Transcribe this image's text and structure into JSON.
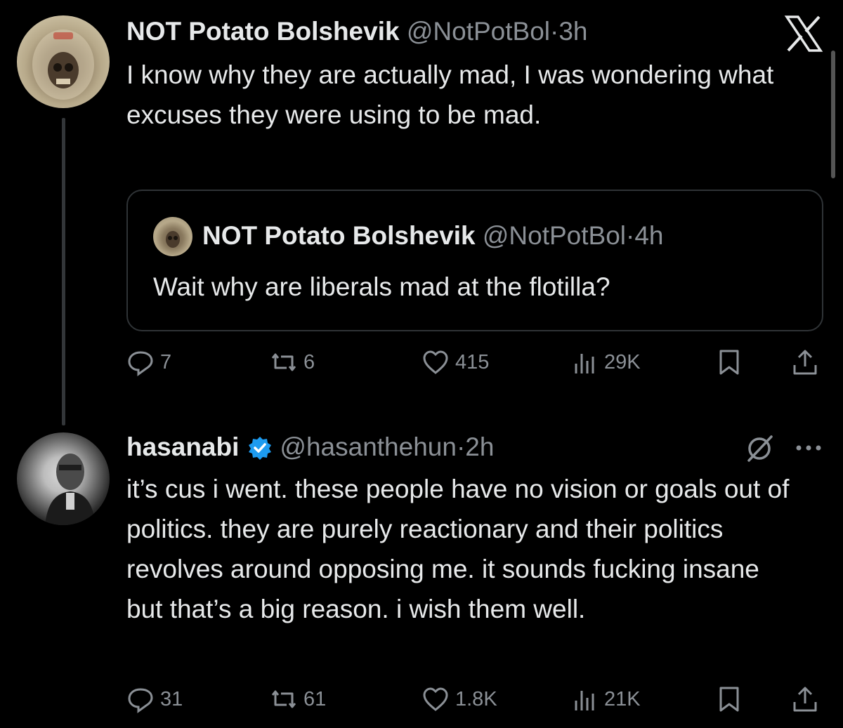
{
  "brand": {
    "logo": "x-logo-icon"
  },
  "colors": {
    "background": "#000000",
    "text": "#e7e9ea",
    "secondary": "#8b9096",
    "verified": "#1d9bf0"
  },
  "tweet1": {
    "author_name": "NOT Potato Bolshevik",
    "handle": "@NotPotBol",
    "separator": "·",
    "time": "3h",
    "text": "I know why they are actually mad, I was wondering what excuses they were using to be mad.",
    "quote": {
      "author_name": "NOT Potato Bolshevik",
      "handle": "@NotPotBol",
      "separator": "·",
      "time": "4h",
      "text": "Wait why are liberals mad at the flotilla?"
    },
    "actions": {
      "replies": "7",
      "retweets": "6",
      "likes": "415",
      "views": "29K"
    }
  },
  "tweet2": {
    "author_name": "hasanabi",
    "verified": true,
    "handle": "@hasanthehun",
    "separator": "·",
    "time": "2h",
    "text": "it’s cus i went. these people have no vision or goals out of politics. they are purely reactionary and their politics revolves around opposing me. it sounds fucking insane but that’s a big reason. i wish them well.",
    "actions": {
      "replies": "31",
      "retweets": "61",
      "likes": "1.8K",
      "views": "21K"
    }
  }
}
